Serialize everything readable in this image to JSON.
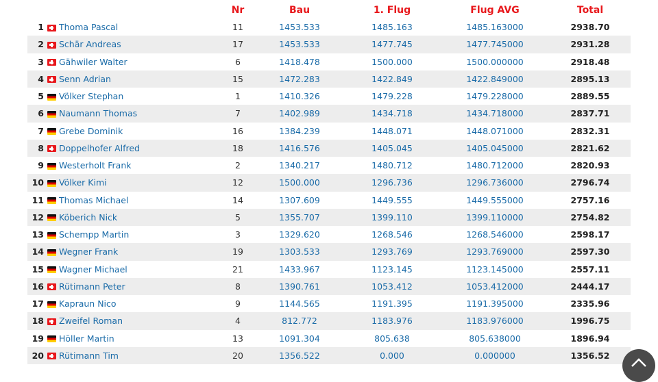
{
  "table": {
    "headers": {
      "rank": "",
      "flag": "",
      "name": "",
      "nr": "Nr",
      "bau": "Bau",
      "flug1": "1. Flug",
      "flug_avg": "Flug AVG",
      "total": "Total"
    },
    "rows": [
      {
        "rank": "1",
        "country": "ch",
        "name": "Thoma Pascal",
        "nr": "11",
        "bau": "1453.533",
        "flug1": "1485.163",
        "flug_avg": "1485.163000",
        "total": "2938.70"
      },
      {
        "rank": "2",
        "country": "ch",
        "name": "Schär Andreas",
        "nr": "17",
        "bau": "1453.533",
        "flug1": "1477.745",
        "flug_avg": "1477.745000",
        "total": "2931.28"
      },
      {
        "rank": "3",
        "country": "ch",
        "name": "Gähwiler Walter",
        "nr": "6",
        "bau": "1418.478",
        "flug1": "1500.000",
        "flug_avg": "1500.000000",
        "total": "2918.48"
      },
      {
        "rank": "4",
        "country": "ch",
        "name": "Senn Adrian",
        "nr": "15",
        "bau": "1472.283",
        "flug1": "1422.849",
        "flug_avg": "1422.849000",
        "total": "2895.13"
      },
      {
        "rank": "5",
        "country": "de",
        "name": "Völker Stephan",
        "nr": "1",
        "bau": "1410.326",
        "flug1": "1479.228",
        "flug_avg": "1479.228000",
        "total": "2889.55"
      },
      {
        "rank": "6",
        "country": "de",
        "name": "Naumann Thomas",
        "nr": "7",
        "bau": "1402.989",
        "flug1": "1434.718",
        "flug_avg": "1434.718000",
        "total": "2837.71"
      },
      {
        "rank": "7",
        "country": "de",
        "name": "Grebe Dominik",
        "nr": "16",
        "bau": "1384.239",
        "flug1": "1448.071",
        "flug_avg": "1448.071000",
        "total": "2832.31"
      },
      {
        "rank": "8",
        "country": "ch",
        "name": "Doppelhofer Alfred",
        "nr": "18",
        "bau": "1416.576",
        "flug1": "1405.045",
        "flug_avg": "1405.045000",
        "total": "2821.62"
      },
      {
        "rank": "9",
        "country": "de",
        "name": "Westerholt Frank",
        "nr": "2",
        "bau": "1340.217",
        "flug1": "1480.712",
        "flug_avg": "1480.712000",
        "total": "2820.93"
      },
      {
        "rank": "10",
        "country": "de",
        "name": "Völker Kimi",
        "nr": "12",
        "bau": "1500.000",
        "flug1": "1296.736",
        "flug_avg": "1296.736000",
        "total": "2796.74"
      },
      {
        "rank": "11",
        "country": "de",
        "name": "Thomas Michael",
        "nr": "14",
        "bau": "1307.609",
        "flug1": "1449.555",
        "flug_avg": "1449.555000",
        "total": "2757.16"
      },
      {
        "rank": "12",
        "country": "de",
        "name": "Köberich Nick",
        "nr": "5",
        "bau": "1355.707",
        "flug1": "1399.110",
        "flug_avg": "1399.110000",
        "total": "2754.82"
      },
      {
        "rank": "13",
        "country": "de",
        "name": "Schempp Martin",
        "nr": "3",
        "bau": "1329.620",
        "flug1": "1268.546",
        "flug_avg": "1268.546000",
        "total": "2598.17"
      },
      {
        "rank": "14",
        "country": "de",
        "name": "Wegner Frank",
        "nr": "19",
        "bau": "1303.533",
        "flug1": "1293.769",
        "flug_avg": "1293.769000",
        "total": "2597.30"
      },
      {
        "rank": "15",
        "country": "de",
        "name": "Wagner Michael",
        "nr": "21",
        "bau": "1433.967",
        "flug1": "1123.145",
        "flug_avg": "1123.145000",
        "total": "2557.11"
      },
      {
        "rank": "16",
        "country": "ch",
        "name": "Rütimann Peter",
        "nr": "8",
        "bau": "1390.761",
        "flug1": "1053.412",
        "flug_avg": "1053.412000",
        "total": "2444.17"
      },
      {
        "rank": "17",
        "country": "de",
        "name": "Kapraun Nico",
        "nr": "9",
        "bau": "1144.565",
        "flug1": "1191.395",
        "flug_avg": "1191.395000",
        "total": "2335.96"
      },
      {
        "rank": "18",
        "country": "ch",
        "name": "Zweifel Roman",
        "nr": "4",
        "bau": "812.772",
        "flug1": "1183.976",
        "flug_avg": "1183.976000",
        "total": "1996.75"
      },
      {
        "rank": "19",
        "country": "de",
        "name": "Höller Martin",
        "nr": "13",
        "bau": "1091.304",
        "flug1": "805.638",
        "flug_avg": "805.638000",
        "total": "1896.94"
      },
      {
        "rank": "20",
        "country": "ch",
        "name": "Rütimann Tim",
        "nr": "20",
        "bau": "1356.522",
        "flug1": "0.000",
        "flug_avg": "0.000000",
        "total": "1356.52"
      }
    ]
  },
  "flag_icons": {
    "ch": "swiss-flag-icon",
    "de": "german-flag-icon"
  },
  "colors": {
    "header": "#e8181c",
    "link": "#1a6ba8",
    "stripe": "#ededed",
    "scroll_button": "#4a4a4a"
  },
  "scroll_top": {
    "icon": "chevron-up-icon"
  }
}
